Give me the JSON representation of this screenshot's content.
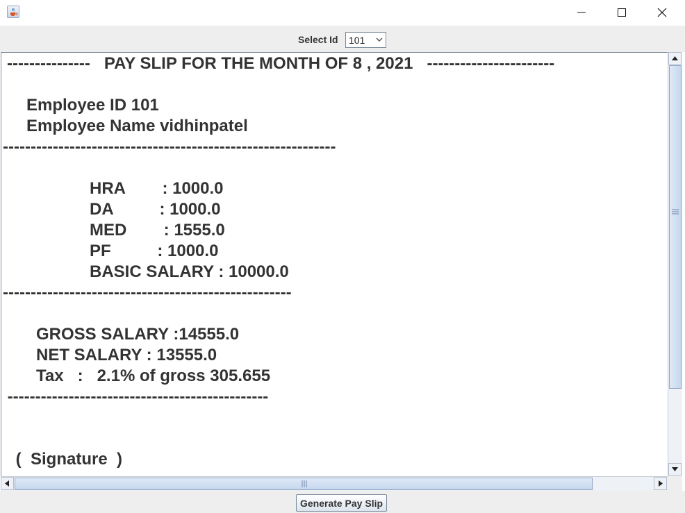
{
  "window": {
    "icon": "java-coffee-cup-icon",
    "controls": [
      "minimize-icon",
      "maximize-icon",
      "close-icon"
    ]
  },
  "toolbar": {
    "select_label": "Select Id",
    "selected_id": "101"
  },
  "payslip": {
    "header": "---------------   PAY SLIP FOR THE MONTH OF 8 , 2021   -----------------------",
    "employee_id": "Employee ID 101",
    "employee_name": "Employee Name vidhinpatel",
    "divider1": "------------------------------------------------------------",
    "hra": "HRA        : 1000.0",
    "da": "DA          : 1000.0",
    "med": "MED        : 1555.0",
    "pf": "PF          : 1000.0",
    "basic_salary": "BASIC SALARY : 10000.0",
    "divider2": "----------------------------------------------------",
    "gross_salary": "GROSS SALARY :14555.0",
    "net_salary": "NET SALARY : 13555.0",
    "tax": "Tax   :   2.1% of gross 305.655",
    "divider3": " -----------------------------------------------",
    "signature": " (  Signature  )"
  },
  "footer": {
    "generate_button": "Generate Pay Slip"
  }
}
